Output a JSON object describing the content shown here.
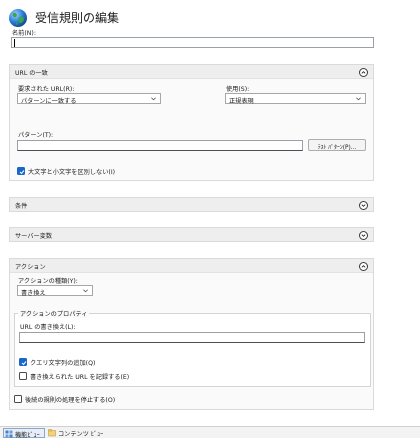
{
  "page": {
    "title": "受信規則の編集"
  },
  "name": {
    "label": "名前(N):",
    "value": ""
  },
  "url_match": {
    "title": "URL の一致",
    "requested_url_label": "要求された URL(R):",
    "requested_url_value": "パターンに一致する",
    "using_label": "使用(S):",
    "using_value": "正規表現",
    "pattern_label": "パターン(T):",
    "pattern_value": "",
    "test_pattern_button": "ﾃｽﾄ ﾊﾟﾀｰﾝ(P)...",
    "ignore_case_label": "大文字と小文字を区別しない(I)",
    "ignore_case_checked": true
  },
  "conditions": {
    "title": "条件"
  },
  "server_variables": {
    "title": "サーバー変数"
  },
  "action": {
    "title": "アクション",
    "type_label": "アクションの種類(Y):",
    "type_value": "書き換え",
    "properties_title": "アクションのプロパティ",
    "rewrite_url_label": "URL の書き換え(L):",
    "rewrite_url_value": "",
    "append_query_label": "クエリ文字列の追加(Q)",
    "append_query_checked": true,
    "log_rewritten_label": "書き換えられた URL を記録する(E)",
    "log_rewritten_checked": false,
    "stop_processing_label": "後続の規則の処理を停止する(O)",
    "stop_processing_checked": false
  },
  "bottom_tabs": [
    {
      "label": "機能ﾋﾞｭｰ",
      "icon": "features-view-icon",
      "active": true
    },
    {
      "label": "コンテンツ ﾋﾞｭｰ",
      "icon": "content-view-icon",
      "active": false
    }
  ],
  "colors": {
    "accent": "#1a66c9",
    "focus_underline": "#1a6fd0",
    "section_header": "#eeeeef"
  }
}
